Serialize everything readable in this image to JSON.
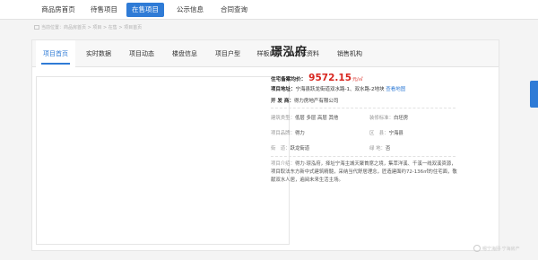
{
  "topnav": {
    "items": [
      "商品房首页",
      "待售项目",
      "在售项目",
      "公示信息",
      "合同查询"
    ],
    "active_index": 2
  },
  "breadcrumb": "当前位置：商品房首页 > 项目 > 在售 > 项目首页",
  "tabs": {
    "items": [
      "项目首页",
      "实时数据",
      "项目动态",
      "楼盘信息",
      "项目户型",
      "样板房",
      "公示资料",
      "销售机构"
    ],
    "active_index": 0
  },
  "project": {
    "name": "璟泓府",
    "price_label": "住宅备案均价：",
    "price_value": "9572.15",
    "price_unit": "元/㎡",
    "address_label": "项目地址：",
    "address_value": "宁海县跃龙街道双水路-1、双水路-2地块",
    "map_link": "查看地图",
    "developer_label": "开 发 商：",
    "developer_value": "得力房地产有限公司",
    "building_type_label": "建筑类型：",
    "building_type_value": "低层 多层 高层 其他",
    "decoration_label": "装修标准：",
    "decoration_value": "白坯房",
    "brand_label": "项目品牌：",
    "brand_value": "得力",
    "district_label": "区　县：",
    "district_value": "宁海县",
    "street_label": "街　道：",
    "street_value": "跃龙街道",
    "rooftop_label": "绿 地：",
    "rooftop_value": "否",
    "intro_label": "项目介绍：",
    "intro_text": "得力·璟泓府，择址宁海主城天聚首席之境，集萃洋溪、千溪一线双溪资源，项目取法东方新中式建筑精髓，采纳当代舒居理念，匠造建面约72-136㎡的住宅面，敬献双水人居，遍阅未来生活主场。"
  },
  "watermark": "嗯宁海网·宁海房产"
}
